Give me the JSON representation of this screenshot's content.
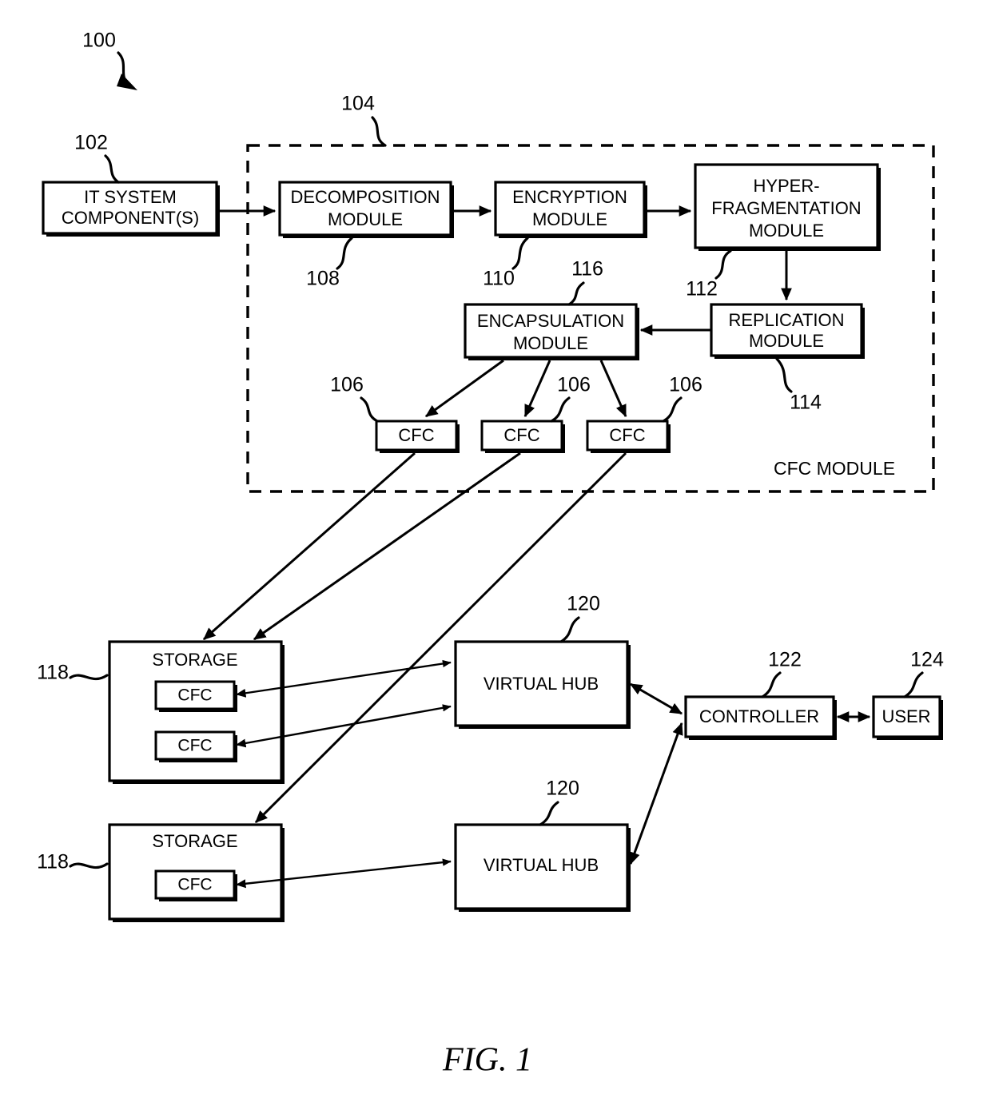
{
  "figure": {
    "caption": "FIG. 1",
    "system_ref": "100"
  },
  "boundary": {
    "label": "CFC MODULE",
    "ref": "104"
  },
  "nodes": {
    "it_system": {
      "line1": "IT SYSTEM",
      "line2": "COMPONENT(S)",
      "ref": "102"
    },
    "decomposition": {
      "line1": "DECOMPOSITION",
      "line2": "MODULE",
      "ref": "108"
    },
    "encryption": {
      "line1": "ENCRYPTION",
      "line2": "MODULE",
      "ref": "110"
    },
    "hyperfragmentation": {
      "line1": "HYPER-",
      "line2": "FRAGMENTATION",
      "line3": "MODULE",
      "ref": "112"
    },
    "replication": {
      "line1": "REPLICATION",
      "line2": "MODULE",
      "ref": "114"
    },
    "encapsulation": {
      "line1": "ENCAPSULATION",
      "line2": "MODULE",
      "ref": "116"
    },
    "controller": {
      "label": "CONTROLLER",
      "ref": "122"
    },
    "user": {
      "label": "USER",
      "ref": "124"
    }
  },
  "cfc_chips": [
    {
      "label": "CFC",
      "ref": "106"
    },
    {
      "label": "CFC",
      "ref": "106"
    },
    {
      "label": "CFC",
      "ref": "106"
    }
  ],
  "storage": [
    {
      "label": "STORAGE",
      "ref": "118",
      "cfcs": [
        {
          "label": "CFC"
        },
        {
          "label": "CFC"
        }
      ]
    },
    {
      "label": "STORAGE",
      "ref": "118",
      "cfcs": [
        {
          "label": "CFC"
        }
      ]
    }
  ],
  "virtual_hubs": [
    {
      "label": "VIRTUAL HUB",
      "ref": "120"
    },
    {
      "label": "VIRTUAL HUB",
      "ref": "120"
    }
  ],
  "colors": {
    "line": "#000000",
    "fill": "#ffffff"
  }
}
